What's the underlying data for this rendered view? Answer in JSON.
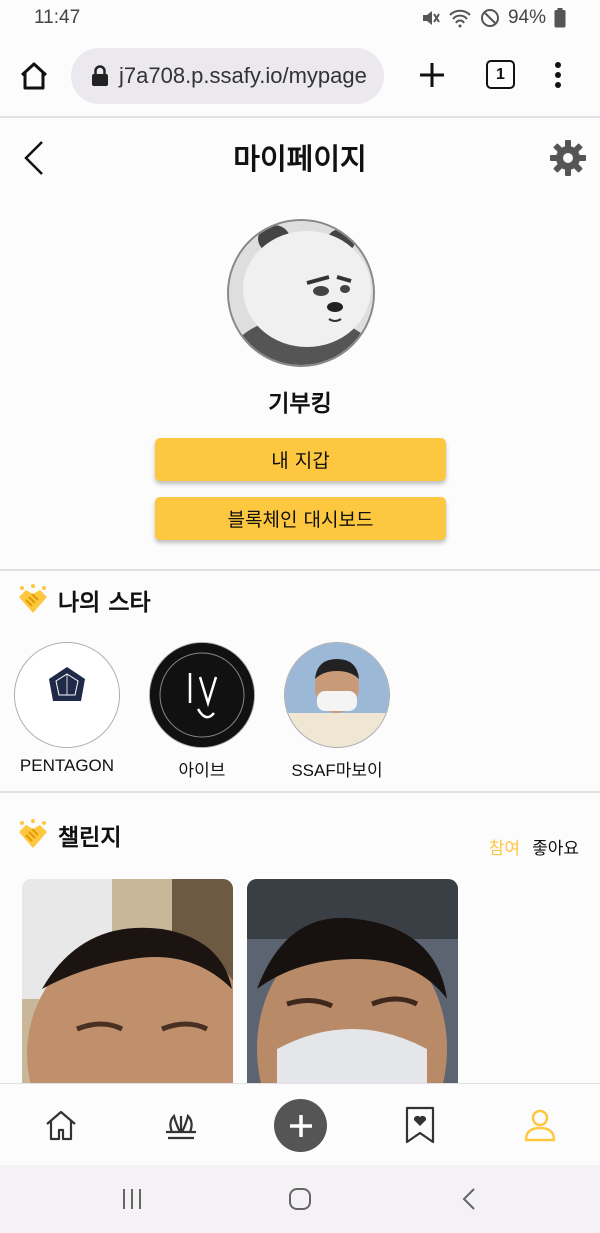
{
  "status": {
    "time": "11:47",
    "battery": "94%"
  },
  "browser": {
    "url": "j7a708.p.ssafy.io/mypage",
    "tab_count": "1"
  },
  "page": {
    "title": "마이페이지",
    "nickname": "기부킹",
    "wallet_label": "내 지갑",
    "dashboard_label": "블록체인 대시보드"
  },
  "my_stars": {
    "title": "나의 스타",
    "items": [
      {
        "name": "PENTAGON"
      },
      {
        "name": "아이브"
      },
      {
        "name": "SSAF마보이"
      }
    ]
  },
  "challenge": {
    "title": "챌린지",
    "tabs": [
      {
        "label": "참여",
        "active": true
      },
      {
        "label": "좋아요",
        "active": false
      }
    ]
  },
  "colors": {
    "accent": "#fdc740",
    "nav_active": "#fdc740",
    "text": "#111111"
  },
  "nav": {
    "items": [
      "home-icon",
      "plant-icon",
      "add-icon",
      "bookmark-heart-icon",
      "profile-icon"
    ],
    "active": "profile-icon"
  }
}
